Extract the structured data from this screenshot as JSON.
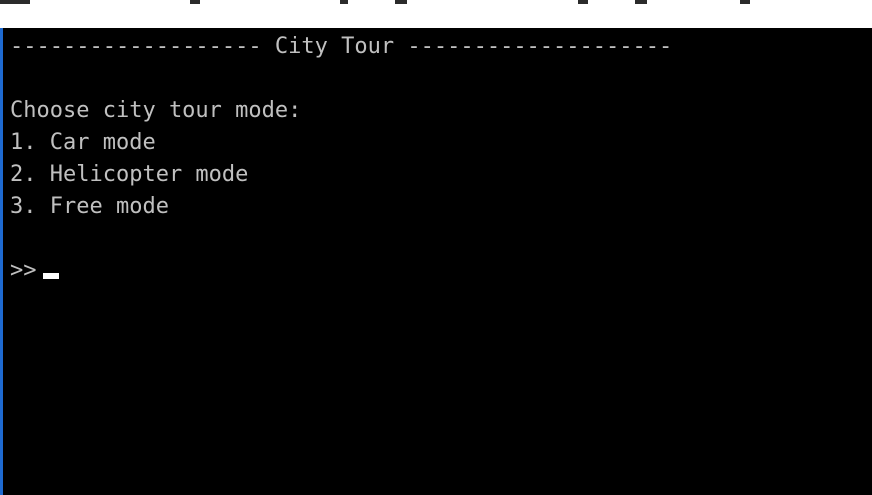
{
  "console": {
    "header": "------------------- City Tour --------------------",
    "blank1": "",
    "prompt_heading": "Choose city tour mode:",
    "options": [
      "1. Car mode",
      "2. Helicopter mode",
      "3. Free mode"
    ],
    "blank2": "",
    "input_prompt": ">>",
    "input_value": ""
  },
  "colors": {
    "background": "#000000",
    "text": "#c0c0c0",
    "cursor": "#ffffff",
    "window_border": "#1e6ad0"
  }
}
